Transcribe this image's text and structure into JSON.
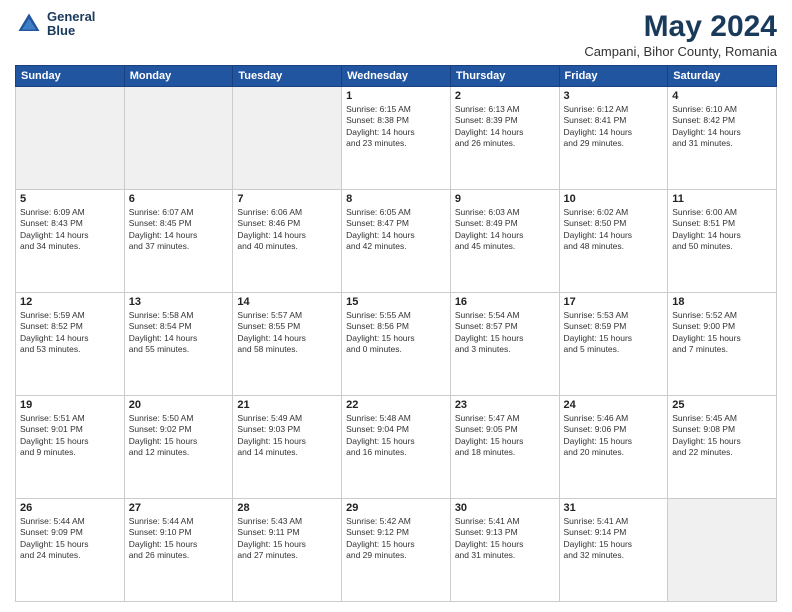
{
  "header": {
    "logo_line1": "General",
    "logo_line2": "Blue",
    "title": "May 2024",
    "location": "Campani, Bihor County, Romania"
  },
  "weekdays": [
    "Sunday",
    "Monday",
    "Tuesday",
    "Wednesday",
    "Thursday",
    "Friday",
    "Saturday"
  ],
  "weeks": [
    [
      {
        "day": "",
        "text": "",
        "empty": true
      },
      {
        "day": "",
        "text": "",
        "empty": true
      },
      {
        "day": "",
        "text": "",
        "empty": true
      },
      {
        "day": "1",
        "text": "Sunrise: 6:15 AM\nSunset: 8:38 PM\nDaylight: 14 hours\nand 23 minutes.",
        "empty": false
      },
      {
        "day": "2",
        "text": "Sunrise: 6:13 AM\nSunset: 8:39 PM\nDaylight: 14 hours\nand 26 minutes.",
        "empty": false
      },
      {
        "day": "3",
        "text": "Sunrise: 6:12 AM\nSunset: 8:41 PM\nDaylight: 14 hours\nand 29 minutes.",
        "empty": false
      },
      {
        "day": "4",
        "text": "Sunrise: 6:10 AM\nSunset: 8:42 PM\nDaylight: 14 hours\nand 31 minutes.",
        "empty": false
      }
    ],
    [
      {
        "day": "5",
        "text": "Sunrise: 6:09 AM\nSunset: 8:43 PM\nDaylight: 14 hours\nand 34 minutes.",
        "empty": false
      },
      {
        "day": "6",
        "text": "Sunrise: 6:07 AM\nSunset: 8:45 PM\nDaylight: 14 hours\nand 37 minutes.",
        "empty": false
      },
      {
        "day": "7",
        "text": "Sunrise: 6:06 AM\nSunset: 8:46 PM\nDaylight: 14 hours\nand 40 minutes.",
        "empty": false
      },
      {
        "day": "8",
        "text": "Sunrise: 6:05 AM\nSunset: 8:47 PM\nDaylight: 14 hours\nand 42 minutes.",
        "empty": false
      },
      {
        "day": "9",
        "text": "Sunrise: 6:03 AM\nSunset: 8:49 PM\nDaylight: 14 hours\nand 45 minutes.",
        "empty": false
      },
      {
        "day": "10",
        "text": "Sunrise: 6:02 AM\nSunset: 8:50 PM\nDaylight: 14 hours\nand 48 minutes.",
        "empty": false
      },
      {
        "day": "11",
        "text": "Sunrise: 6:00 AM\nSunset: 8:51 PM\nDaylight: 14 hours\nand 50 minutes.",
        "empty": false
      }
    ],
    [
      {
        "day": "12",
        "text": "Sunrise: 5:59 AM\nSunset: 8:52 PM\nDaylight: 14 hours\nand 53 minutes.",
        "empty": false
      },
      {
        "day": "13",
        "text": "Sunrise: 5:58 AM\nSunset: 8:54 PM\nDaylight: 14 hours\nand 55 minutes.",
        "empty": false
      },
      {
        "day": "14",
        "text": "Sunrise: 5:57 AM\nSunset: 8:55 PM\nDaylight: 14 hours\nand 58 minutes.",
        "empty": false
      },
      {
        "day": "15",
        "text": "Sunrise: 5:55 AM\nSunset: 8:56 PM\nDaylight: 15 hours\nand 0 minutes.",
        "empty": false
      },
      {
        "day": "16",
        "text": "Sunrise: 5:54 AM\nSunset: 8:57 PM\nDaylight: 15 hours\nand 3 minutes.",
        "empty": false
      },
      {
        "day": "17",
        "text": "Sunrise: 5:53 AM\nSunset: 8:59 PM\nDaylight: 15 hours\nand 5 minutes.",
        "empty": false
      },
      {
        "day": "18",
        "text": "Sunrise: 5:52 AM\nSunset: 9:00 PM\nDaylight: 15 hours\nand 7 minutes.",
        "empty": false
      }
    ],
    [
      {
        "day": "19",
        "text": "Sunrise: 5:51 AM\nSunset: 9:01 PM\nDaylight: 15 hours\nand 9 minutes.",
        "empty": false
      },
      {
        "day": "20",
        "text": "Sunrise: 5:50 AM\nSunset: 9:02 PM\nDaylight: 15 hours\nand 12 minutes.",
        "empty": false
      },
      {
        "day": "21",
        "text": "Sunrise: 5:49 AM\nSunset: 9:03 PM\nDaylight: 15 hours\nand 14 minutes.",
        "empty": false
      },
      {
        "day": "22",
        "text": "Sunrise: 5:48 AM\nSunset: 9:04 PM\nDaylight: 15 hours\nand 16 minutes.",
        "empty": false
      },
      {
        "day": "23",
        "text": "Sunrise: 5:47 AM\nSunset: 9:05 PM\nDaylight: 15 hours\nand 18 minutes.",
        "empty": false
      },
      {
        "day": "24",
        "text": "Sunrise: 5:46 AM\nSunset: 9:06 PM\nDaylight: 15 hours\nand 20 minutes.",
        "empty": false
      },
      {
        "day": "25",
        "text": "Sunrise: 5:45 AM\nSunset: 9:08 PM\nDaylight: 15 hours\nand 22 minutes.",
        "empty": false
      }
    ],
    [
      {
        "day": "26",
        "text": "Sunrise: 5:44 AM\nSunset: 9:09 PM\nDaylight: 15 hours\nand 24 minutes.",
        "empty": false
      },
      {
        "day": "27",
        "text": "Sunrise: 5:44 AM\nSunset: 9:10 PM\nDaylight: 15 hours\nand 26 minutes.",
        "empty": false
      },
      {
        "day": "28",
        "text": "Sunrise: 5:43 AM\nSunset: 9:11 PM\nDaylight: 15 hours\nand 27 minutes.",
        "empty": false
      },
      {
        "day": "29",
        "text": "Sunrise: 5:42 AM\nSunset: 9:12 PM\nDaylight: 15 hours\nand 29 minutes.",
        "empty": false
      },
      {
        "day": "30",
        "text": "Sunrise: 5:41 AM\nSunset: 9:13 PM\nDaylight: 15 hours\nand 31 minutes.",
        "empty": false
      },
      {
        "day": "31",
        "text": "Sunrise: 5:41 AM\nSunset: 9:14 PM\nDaylight: 15 hours\nand 32 minutes.",
        "empty": false
      },
      {
        "day": "",
        "text": "",
        "empty": true
      }
    ]
  ]
}
